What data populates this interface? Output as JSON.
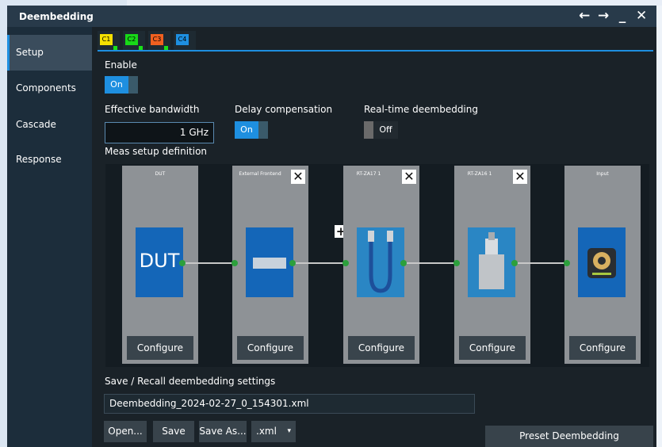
{
  "window": {
    "title": "Deembedding",
    "controls": [
      "←",
      "→",
      "_",
      "✕"
    ]
  },
  "sidebar": {
    "items": [
      {
        "label": "Setup",
        "active": true
      },
      {
        "label": "Components"
      },
      {
        "label": "Cascade"
      },
      {
        "label": "Response"
      }
    ]
  },
  "channels": [
    {
      "label": "C1",
      "color": "#f5e000"
    },
    {
      "label": "C2",
      "color": "#18d818"
    },
    {
      "label": "C3",
      "color": "#f06020"
    },
    {
      "label": "C4",
      "color": "#1e8fe0"
    }
  ],
  "enable": {
    "label": "Enable",
    "state": "On"
  },
  "bandwidth": {
    "label": "Effective bandwidth",
    "value": "1 GHz"
  },
  "delay": {
    "label": "Delay compensation",
    "state": "On"
  },
  "realtime": {
    "label": "Real-time deembedding",
    "state": "Off"
  },
  "meas": {
    "label": "Meas setup definition",
    "add_symbol": "+",
    "components": [
      {
        "title": "DUT",
        "image_text": "DUT",
        "configure": "Configure",
        "removable": false
      },
      {
        "title": "External Frontend",
        "configure": "Configure",
        "removable": true
      },
      {
        "title": "RT-ZA17 1",
        "configure": "Configure",
        "removable": true
      },
      {
        "title": "RT-ZA16 1",
        "configure": "Configure",
        "removable": true
      },
      {
        "title": "Input",
        "configure": "Configure",
        "removable": false
      }
    ],
    "remove_symbol": "✕"
  },
  "save": {
    "label": "Save / Recall deembedding settings",
    "filename": "Deembedding_2024-02-27_0_154301.xml",
    "open": "Open...",
    "save": "Save",
    "save_as": "Save As...",
    "format": ".xml",
    "format_arrow": "▾"
  },
  "preset": "Preset Deembedding"
}
